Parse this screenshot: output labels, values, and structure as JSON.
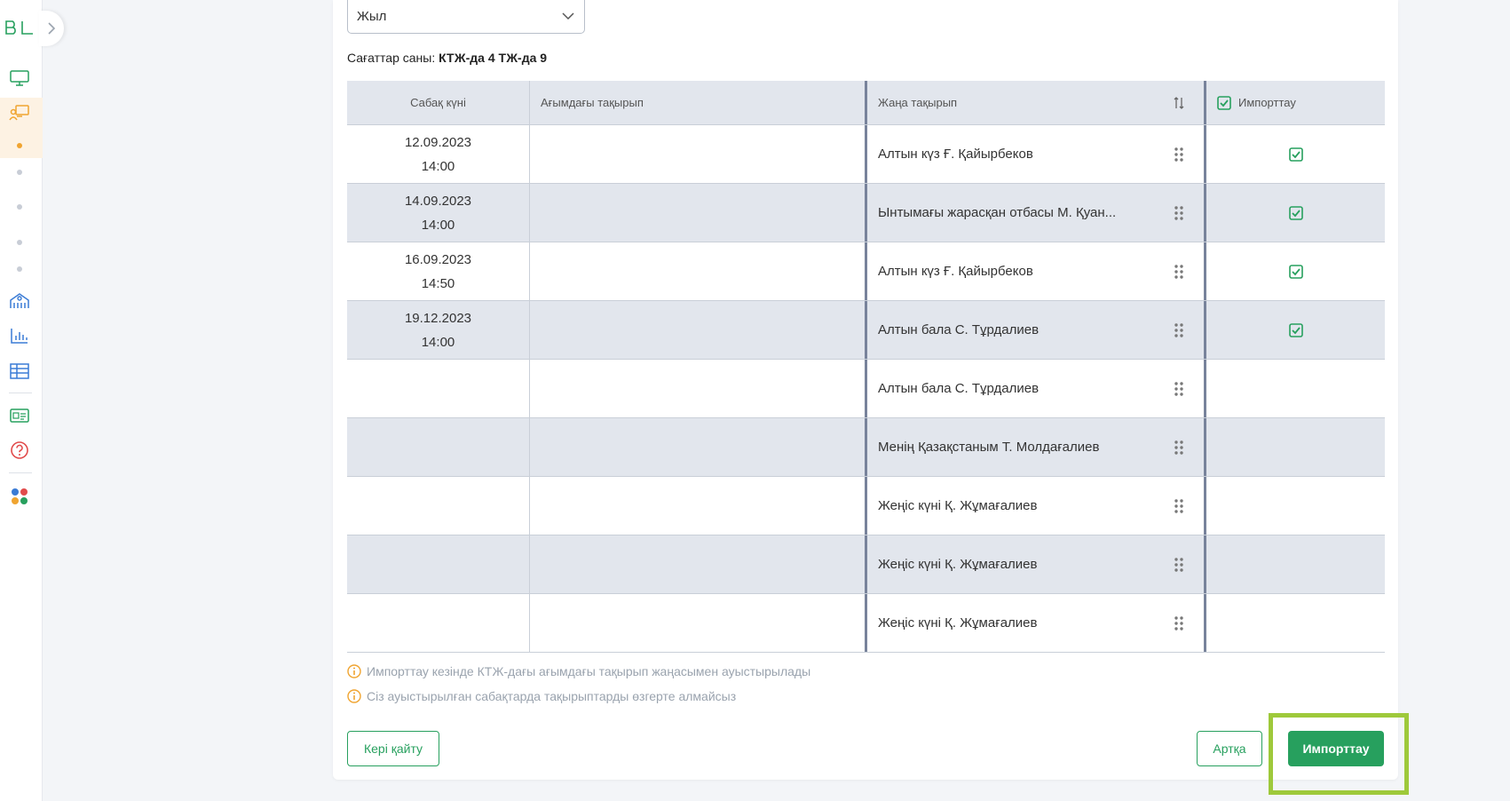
{
  "sidebar": {
    "logo_text": "BL",
    "icons": [
      "monitor-icon",
      "teacher-board-icon",
      "school-building-icon",
      "bar-chart-icon",
      "table-grid-icon",
      "id-card-icon",
      "help-circle-icon",
      "apps-grid-icon"
    ]
  },
  "filter": {
    "year_label": "Жыл"
  },
  "hours": {
    "label": "Сағаттар саны:",
    "value": "КТЖ-да 4 ТЖ-да 9"
  },
  "table": {
    "headers": {
      "date": "Сабақ күні",
      "current": "Ағымдағы тақырып",
      "new": "Жаңа тақырып",
      "import": "Импорттау"
    },
    "rows": [
      {
        "date": "12.09.2023",
        "time": "14:00",
        "current": "",
        "new": "Алтын күз Ғ. Қайырбеков",
        "checked": true
      },
      {
        "date": "14.09.2023",
        "time": "14:00",
        "current": "",
        "new": "Ынтымағы жарасқан отбасы М. Қуан...",
        "checked": true
      },
      {
        "date": "16.09.2023",
        "time": "14:50",
        "current": "",
        "new": "Алтын күз Ғ. Қайырбеков",
        "checked": true
      },
      {
        "date": "19.12.2023",
        "time": "14:00",
        "current": "",
        "new": "Алтын бала С. Тұрдалиев",
        "checked": true
      },
      {
        "date": "",
        "time": "",
        "current": "",
        "new": "Алтын бала С. Тұрдалиев",
        "checked": false
      },
      {
        "date": "",
        "time": "",
        "current": "",
        "new": "Менің Қазақстаным Т. Молдағалиев",
        "checked": false
      },
      {
        "date": "",
        "time": "",
        "current": "",
        "new": "Жеңіс күні Қ. Жұмағалиев",
        "checked": false
      },
      {
        "date": "",
        "time": "",
        "current": "",
        "new": "Жеңіс күні Қ. Жұмағалиев",
        "checked": false
      },
      {
        "date": "",
        "time": "",
        "current": "",
        "new": "Жеңіс күні Қ. Жұмағалиев",
        "checked": false
      }
    ]
  },
  "notes": [
    "Импорттау кезінде КТЖ-дағы ағымдағы тақырып жаңасымен ауыстырылады",
    "Сіз ауыстырылған сабақтарда тақырыптарды өзгерте алмайсыз"
  ],
  "buttons": {
    "back_home": "Кері қайту",
    "back": "Артқа",
    "import": "Импорттау"
  },
  "colors": {
    "accent": "#27a05e",
    "info": "#f0a430",
    "highlight": "#9ec93b"
  }
}
